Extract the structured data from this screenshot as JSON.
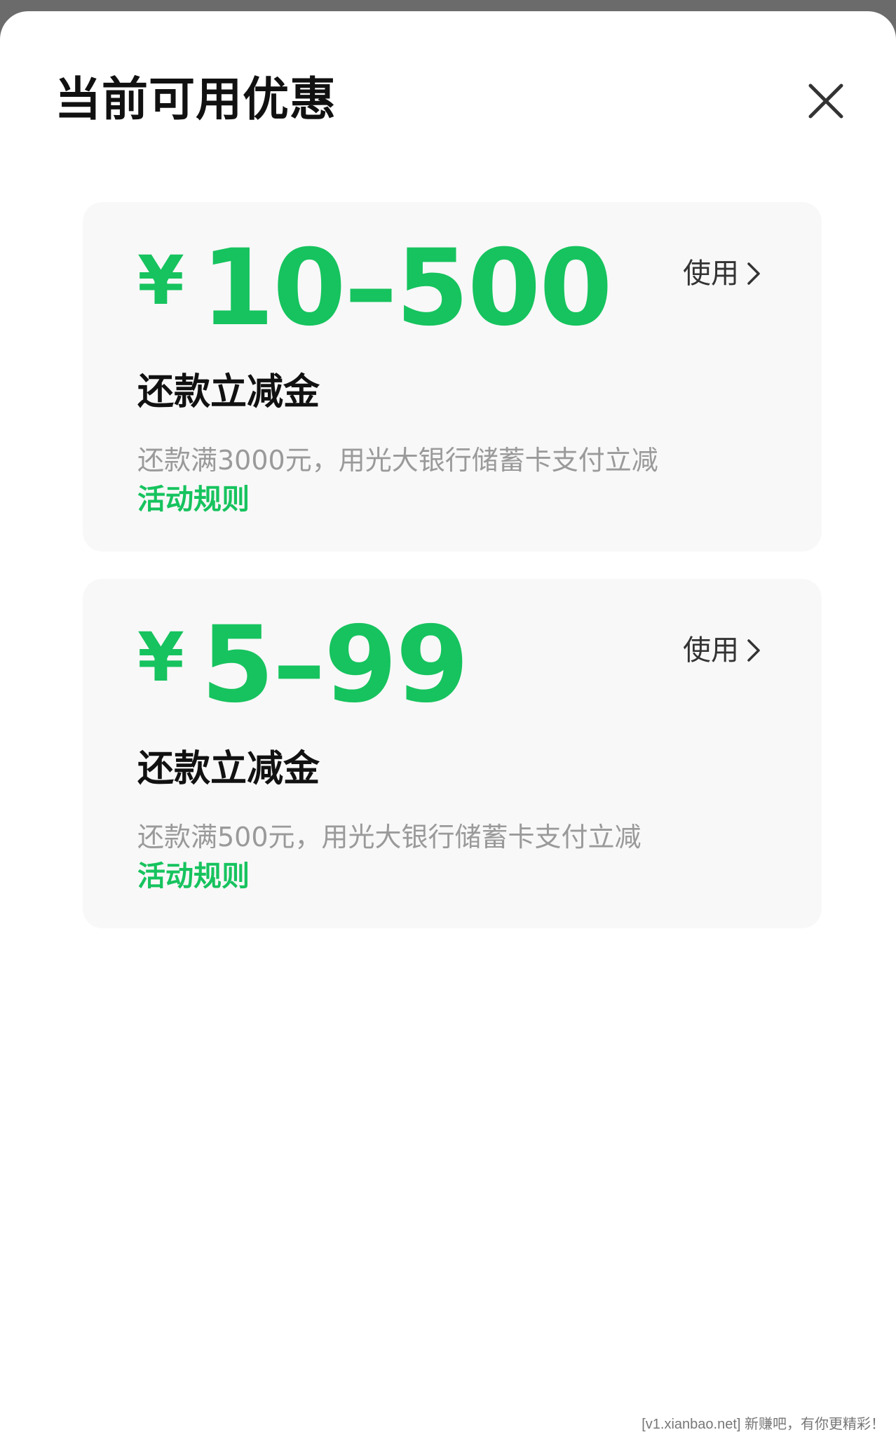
{
  "header": {
    "title": "当前可用优惠",
    "close_icon": "close-icon"
  },
  "coupons": [
    {
      "currency": "¥",
      "range": "10–500",
      "use_label": "使用",
      "name": "还款立减金",
      "description": "还款满3000元，用光大银行储蓄卡支付立减",
      "rules_label": "活动规则"
    },
    {
      "currency": "¥",
      "range": "5–99",
      "use_label": "使用",
      "name": "还款立减金",
      "description": "还款满500元，用光大银行储蓄卡支付立减",
      "rules_label": "活动规则"
    }
  ],
  "watermark": "[v1.xianbao.net] 新赚吧，有你更精彩！",
  "colors": {
    "accent": "#16c35e",
    "card_bg": "#f8f8f8",
    "text_primary": "#111111",
    "text_secondary": "#9a9a9a",
    "backdrop": "#6b6b6b"
  }
}
